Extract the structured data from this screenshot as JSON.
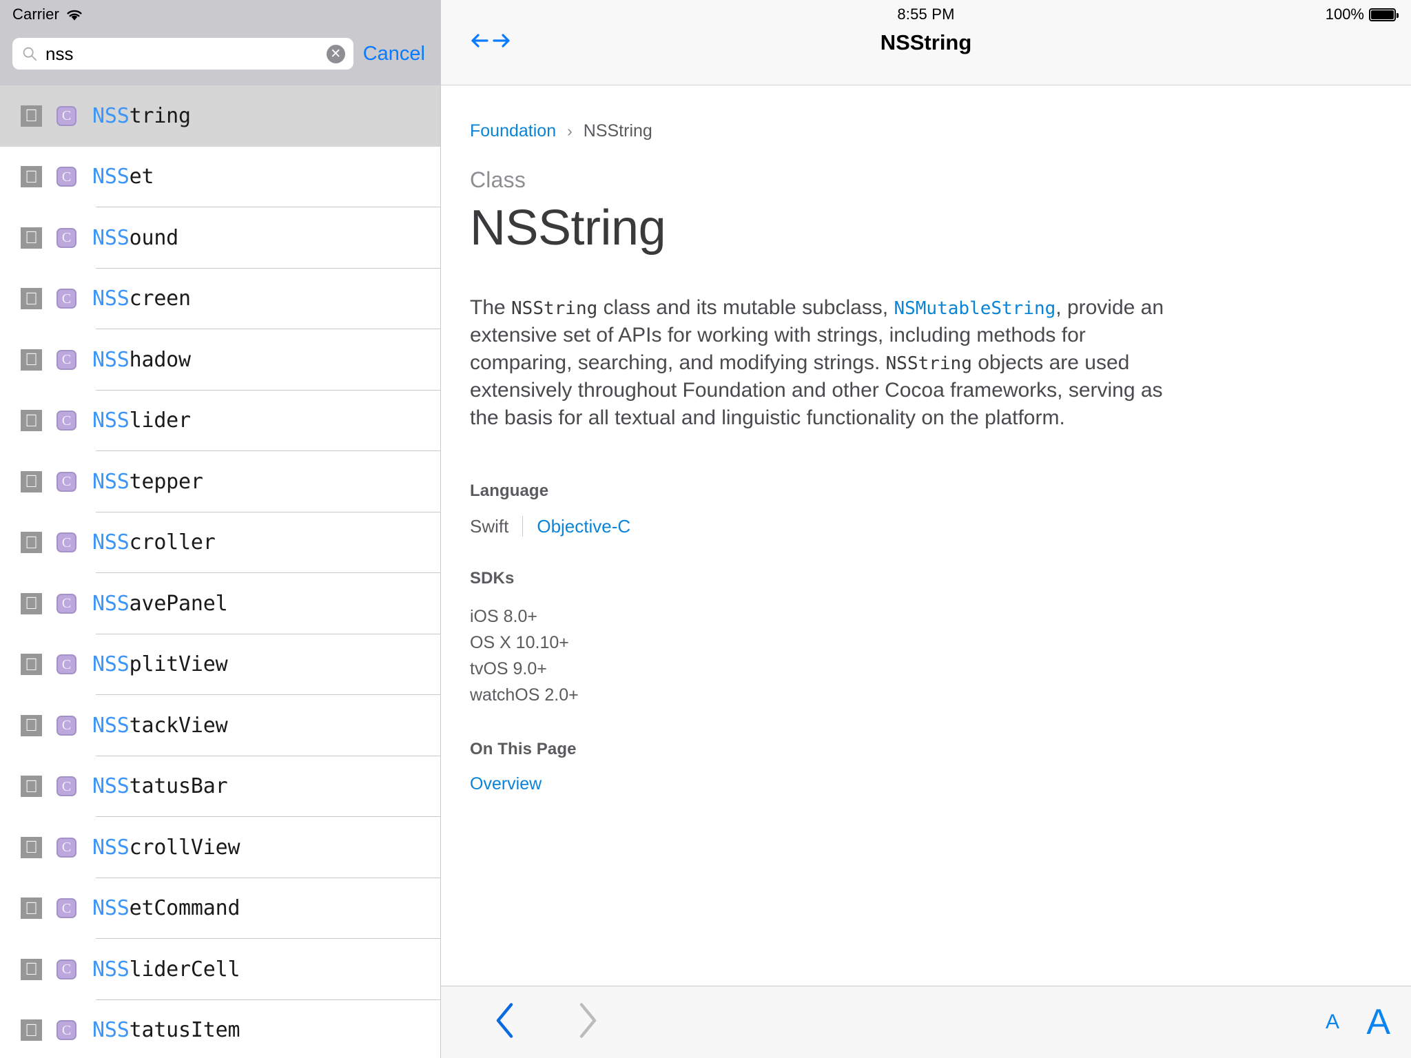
{
  "status_bar": {
    "carrier": "Carrier",
    "wifi_icon": "wifi-icon",
    "time": "8:55 PM",
    "battery_percent": "100%",
    "battery_icon": "battery-full-icon"
  },
  "search": {
    "value": "nss",
    "placeholder": "Search",
    "cancel_label": "Cancel",
    "search_icon": "search-icon",
    "clear_icon": "clear-text-icon"
  },
  "results": [
    {
      "prefix": "NSS",
      "suffix": "tring",
      "platform_icon": "apple-icon",
      "kind_badge": "C",
      "selected": true
    },
    {
      "prefix": "NSS",
      "suffix": "et",
      "platform_icon": "apple-icon",
      "kind_badge": "C",
      "selected": false
    },
    {
      "prefix": "NSS",
      "suffix": "ound",
      "platform_icon": "apple-icon",
      "kind_badge": "C",
      "selected": false
    },
    {
      "prefix": "NSS",
      "suffix": "creen",
      "platform_icon": "apple-icon",
      "kind_badge": "C",
      "selected": false
    },
    {
      "prefix": "NSS",
      "suffix": "hadow",
      "platform_icon": "apple-icon",
      "kind_badge": "C",
      "selected": false
    },
    {
      "prefix": "NSS",
      "suffix": "lider",
      "platform_icon": "apple-icon",
      "kind_badge": "C",
      "selected": false
    },
    {
      "prefix": "NSS",
      "suffix": "tepper",
      "platform_icon": "apple-icon",
      "kind_badge": "C",
      "selected": false
    },
    {
      "prefix": "NSS",
      "suffix": "croller",
      "platform_icon": "apple-icon",
      "kind_badge": "C",
      "selected": false
    },
    {
      "prefix": "NSS",
      "suffix": "avePanel",
      "platform_icon": "apple-icon",
      "kind_badge": "C",
      "selected": false
    },
    {
      "prefix": "NSS",
      "suffix": "plitView",
      "platform_icon": "apple-icon",
      "kind_badge": "C",
      "selected": false
    },
    {
      "prefix": "NSS",
      "suffix": "tackView",
      "platform_icon": "apple-icon",
      "kind_badge": "C",
      "selected": false
    },
    {
      "prefix": "NSS",
      "suffix": "tatusBar",
      "platform_icon": "apple-icon",
      "kind_badge": "C",
      "selected": false
    },
    {
      "prefix": "NSS",
      "suffix": "crollView",
      "platform_icon": "apple-icon",
      "kind_badge": "C",
      "selected": false
    },
    {
      "prefix": "NSS",
      "suffix": "etCommand",
      "platform_icon": "apple-icon",
      "kind_badge": "C",
      "selected": false
    },
    {
      "prefix": "NSS",
      "suffix": "liderCell",
      "platform_icon": "apple-icon",
      "kind_badge": "C",
      "selected": false
    },
    {
      "prefix": "NSS",
      "suffix": "tatusItem",
      "platform_icon": "apple-icon",
      "kind_badge": "C",
      "selected": false
    }
  ],
  "nav_bar": {
    "title": "NSString",
    "history_icon": "left-right-arrows-icon"
  },
  "detail": {
    "breadcrumb": {
      "parent": "Foundation",
      "separator": "›",
      "current": "NSString"
    },
    "eyebrow": "Class",
    "title": "NSString",
    "abstract": {
      "p1_a": "The ",
      "p1_code1": "NSString",
      "p1_b": " class and its mutable subclass, ",
      "p1_link": "NSMutableString",
      "p1_c": ", provide an extensive set of APIs for working with strings, including methods for comparing, searching, and modifying strings. ",
      "p1_code2": "NSString",
      "p1_d": " objects are used extensively throughout Foundation and other Cocoa frameworks, serving as the basis for all textual and linguistic functionality on the platform."
    },
    "language": {
      "heading": "Language",
      "selected": "Swift",
      "alternate": "Objective-C"
    },
    "sdks": {
      "heading": "SDKs",
      "items": [
        "iOS 8.0+",
        "OS X 10.10+",
        "tvOS 9.0+",
        "watchOS 2.0+"
      ]
    },
    "on_this_page": {
      "heading": "On This Page",
      "items": [
        "Overview"
      ]
    }
  },
  "toolbar": {
    "back_icon": "chevron-left-icon",
    "back_enabled": true,
    "forward_icon": "chevron-right-icon",
    "forward_enabled": false,
    "text_size_small": "A",
    "text_size_large": "A"
  },
  "colors": {
    "accent_blue": "#0a84d6",
    "ios_blue": "#0a7bff",
    "match_highlight": "#3d96f7",
    "badge_purple": "#bda8dd",
    "sidebar_chrome": "#c9c9ce",
    "selected_row": "#d6d6d6"
  }
}
